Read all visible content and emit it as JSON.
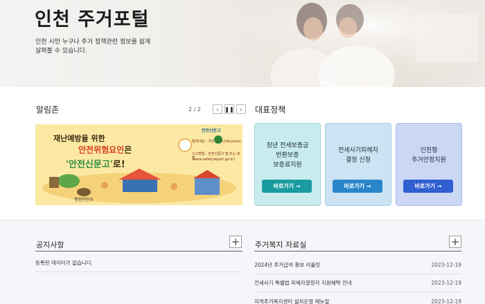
{
  "hero": {
    "title": "인천 주거포털",
    "description_line1": "인천 시민 누구나 주거 정책관련 정보를 쉽게",
    "description_line2": "살펴볼 수 있습니다."
  },
  "notice_banner": {
    "section_title": "알림존",
    "pager_count": "2 / 2",
    "prev_icon": "chevron-left-icon",
    "pause_icon": "pause-icon",
    "next_icon": "chevron-right-icon",
    "banner": {
      "logo_text": "안전신문고",
      "headline1": "재난예방을 위한",
      "headline2_red": "안전위험요인",
      "headline2_dark": "은",
      "headline3_green": "'안전신문고'",
      "headline3_dark": "로!",
      "sub1": "참여대상 : 국민 누구나(Anyone)",
      "sub2": "신고방법 : 안전신문고 앱 또는 포털",
      "sub3": "(www.safetyreport.go.kr)",
      "footer": "행정안전부"
    }
  },
  "policy": {
    "section_title": "대표정책",
    "cards": [
      {
        "text": "청년 전세보증금\n반환보증\n보증료지원",
        "button": "바로가기 →",
        "color": "#199ba0"
      },
      {
        "text": "전세사기피해자\n결정 신청",
        "button": "바로가기 →",
        "color": "#2a86c9"
      },
      {
        "text": "인천형\n주거안정지원",
        "button": "바로가기 →",
        "color": "#2f5fd0"
      }
    ]
  },
  "notices": {
    "title": "공지사항",
    "plus_icon": "plus-icon",
    "empty_text": "등록된 데이터가 없습니다."
  },
  "welfare": {
    "title": "주거복지 자료실",
    "plus_icon": "plus-icon",
    "items": [
      {
        "title": "2024년 주거급여 홍보 리플릿",
        "date": "2023-12-19"
      },
      {
        "title": "전세사기 특별법 피해자결정자 지원혜택 안내",
        "date": "2023-12-19"
      },
      {
        "title": "지역주거복지센터 설치운영 매뉴얼",
        "date": "2023-12-19"
      }
    ]
  }
}
